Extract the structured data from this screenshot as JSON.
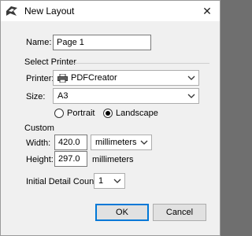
{
  "window": {
    "title": "New Layout",
    "close_glyph": "✕"
  },
  "name": {
    "label": "Name:",
    "value": "Page 1"
  },
  "select_printer": {
    "heading": "Select Printer",
    "printer": {
      "label": "Printer:",
      "value": "PDFCreator",
      "icon": "printer-icon"
    },
    "size": {
      "label": "Size:",
      "value": "A3"
    },
    "orientation": {
      "portrait": {
        "label": "Portrait",
        "selected": false
      },
      "landscape": {
        "label": "Landscape",
        "selected": true
      }
    }
  },
  "custom": {
    "heading": "Custom",
    "width": {
      "label": "Width:",
      "value": "420.0",
      "unit": "millimeters"
    },
    "height": {
      "label": "Height:",
      "value": "297.0",
      "unit": "millimeters"
    }
  },
  "detail_count": {
    "label": "Initial Detail Count:",
    "value": "1"
  },
  "buttons": {
    "ok": "OK",
    "cancel": "Cancel"
  }
}
